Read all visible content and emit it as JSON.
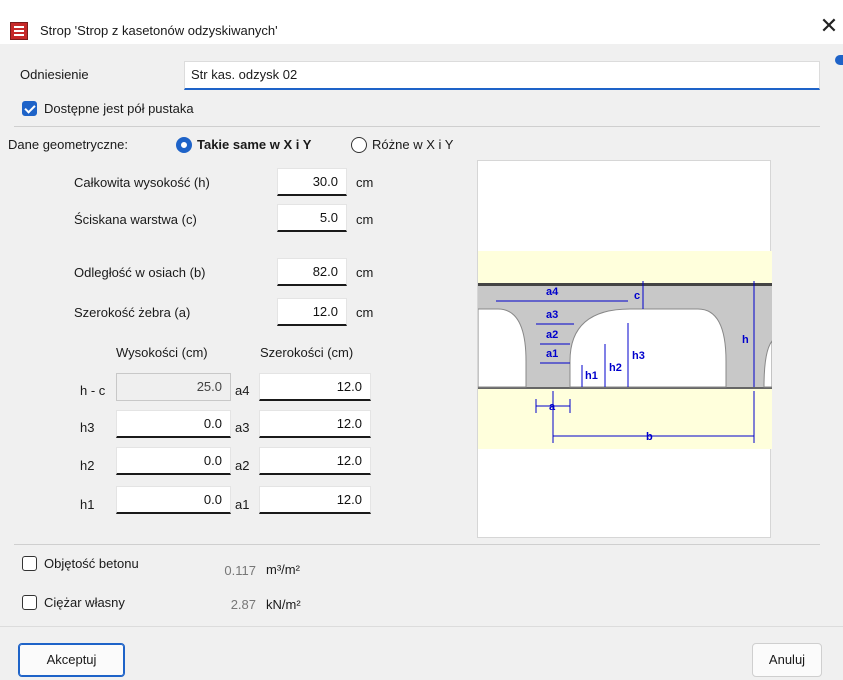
{
  "window": {
    "title": "Strop 'Strop z kasetonów odzyskiwanych'",
    "close_glyph": "✕"
  },
  "reference": {
    "label": "Odniesienie",
    "value": "Str kas. odzysk 02"
  },
  "half_block": {
    "label": "Dostępne jest pół pustaka",
    "checked": true
  },
  "geometry": {
    "label": "Dane geometryczne:",
    "option_same": "Takie same w X i Y",
    "option_diff": "Różne w X i Y",
    "selected": "same"
  },
  "fields": {
    "h": {
      "label": "Całkowita wysokość (h)",
      "value": "30.0",
      "unit": "cm"
    },
    "c": {
      "label": "Ściskana warstwa (c)",
      "value": "5.0",
      "unit": "cm"
    },
    "b": {
      "label": "Odległość w osiach (b)",
      "value": "82.0",
      "unit": "cm"
    },
    "a": {
      "label": "Szerokość żebra (a)",
      "value": "12.0",
      "unit": "cm"
    }
  },
  "table": {
    "header_heights": "Wysokości (cm)",
    "header_widths": "Szerokości (cm)",
    "rows": [
      {
        "row_label": "h - c",
        "height": "25.0",
        "width_label": "a4",
        "width": "12.0",
        "height_disabled": true
      },
      {
        "row_label": "h3",
        "height": "0.0",
        "width_label": "a3",
        "width": "12.0",
        "height_disabled": false
      },
      {
        "row_label": "h2",
        "height": "0.0",
        "width_label": "a2",
        "width": "12.0",
        "height_disabled": false
      },
      {
        "row_label": "h1",
        "height": "0.0",
        "width_label": "a1",
        "width": "12.0",
        "height_disabled": false
      }
    ]
  },
  "diagram_labels": {
    "a4": "a4",
    "a3": "a3",
    "a2": "a2",
    "a1": "a1",
    "c": "c",
    "h": "h",
    "h3": "h3",
    "h2": "h2",
    "h1": "h1",
    "a": "a",
    "b": "b"
  },
  "volume": {
    "label": "Objętość betonu",
    "value": "0.117",
    "unit": "m³/m²",
    "checked": false
  },
  "weight": {
    "label": "Ciężar własny",
    "value": "2.87",
    "unit": "kN/m²",
    "checked": false
  },
  "buttons": {
    "accept": "Akceptuj",
    "cancel": "Anuluj"
  },
  "colors": {
    "accent": "#1e63c8",
    "diagram_blue": "#0000cc",
    "slab_yellow": "#ffffdc",
    "concrete_gray": "#c8c8c8"
  }
}
